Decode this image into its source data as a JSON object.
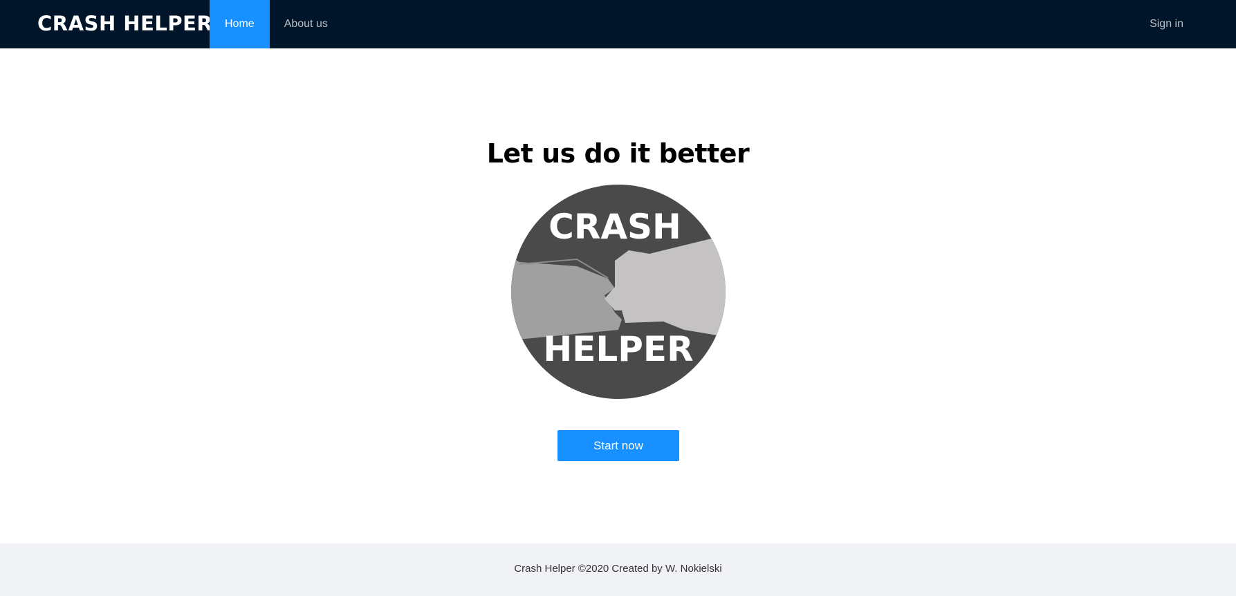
{
  "header": {
    "brand": "CRASH HELPER",
    "nav": [
      {
        "label": "Home",
        "active": true
      },
      {
        "label": "About us",
        "active": false
      }
    ],
    "sign_in": "Sign in"
  },
  "main": {
    "headline": "Let us do it better",
    "logo": {
      "top_text": "CRASH",
      "bottom_text": "HELPER",
      "icon": "car-crash-logo"
    },
    "start_button": "Start now"
  },
  "footer": {
    "text": "Crash Helper ©2020 Created by W. Nokielski"
  },
  "colors": {
    "header_bg": "#001529",
    "accent": "#1890ff",
    "footer_bg": "#f0f2f5",
    "logo_dark": "#4a4a4a",
    "car_left": "#a0a0a0",
    "car_right": "#c4c2c2"
  }
}
